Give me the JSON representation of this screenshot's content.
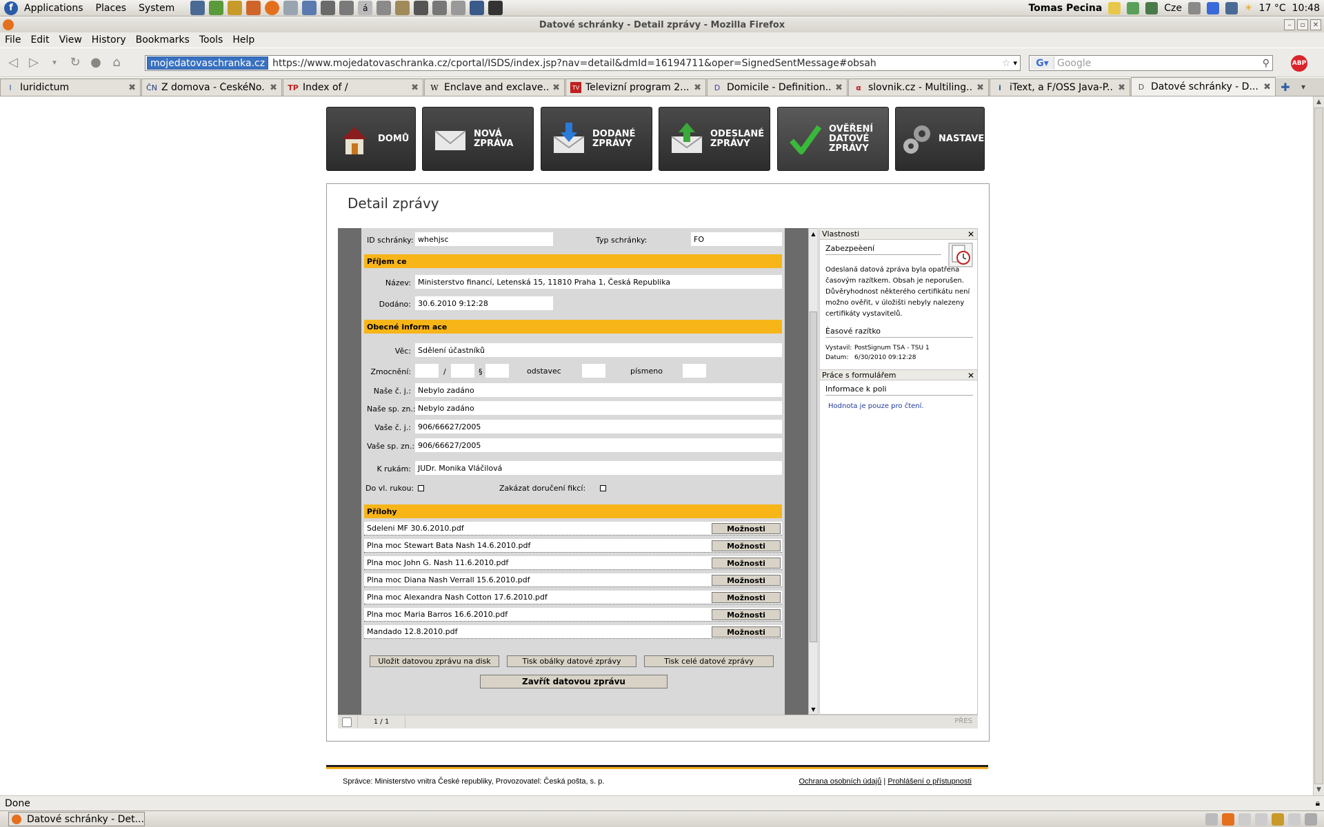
{
  "panel": {
    "menus": [
      "Applications",
      "Places",
      "System"
    ],
    "user": "Tomas Pecina",
    "keyboard": "Cze",
    "weather": "17 °C",
    "clock": "10:48"
  },
  "window": {
    "title": "Datové schránky - Detail zprávy - Mozilla Firefox"
  },
  "menubar": [
    "File",
    "Edit",
    "View",
    "History",
    "Bookmarks",
    "Tools",
    "Help"
  ],
  "navbar": {
    "site": "mojedatovaschranka.cz",
    "url": "https://www.mojedatovaschranka.cz/cportal/ISDS/index.jsp?nav=detail&dmId=16194711&oper=SignedSentMessage#obsah",
    "search_placeholder": "Google"
  },
  "tabs": [
    {
      "label": "Iuridictum",
      "icon": "I"
    },
    {
      "label": "Z domova - ČeskéNo...",
      "icon": "ČN"
    },
    {
      "label": "Index of /",
      "icon": "TP"
    },
    {
      "label": "Enclave and exclave...",
      "icon": "W"
    },
    {
      "label": "Televizní program 2...",
      "icon": "TV"
    },
    {
      "label": "Domicile - Definition...",
      "icon": "D"
    },
    {
      "label": "slovnik.cz - Multiling...",
      "icon": "α"
    },
    {
      "label": "iText, a F/OSS Java-P...",
      "icon": "i"
    },
    {
      "label": "Datové schránky - D...",
      "icon": "D"
    }
  ],
  "nav_buttons": [
    {
      "label1": "DOMŮ",
      "label2": "",
      "label3": ""
    },
    {
      "label1": "NOVÁ",
      "label2": "ZPRÁVA",
      "label3": ""
    },
    {
      "label1": "DODANÉ",
      "label2": "ZPRÁVY",
      "label3": ""
    },
    {
      "label1": "ODESLANÉ",
      "label2": "ZPRÁVY",
      "label3": ""
    },
    {
      "label1": "OVĚŘENÍ",
      "label2": "DATOVÉ",
      "label3": "ZPRÁVY"
    },
    {
      "label1": "NASTAVENÍ",
      "label2": "",
      "label3": ""
    }
  ],
  "detail": {
    "heading": "Detail zprávy",
    "id_label": "ID schránky:",
    "id_value": "whehjsc",
    "typ_label": "Typ schránky:",
    "typ_value": "FO",
    "sect_recipient": "Příjem ce",
    "nazev_label": "Název:",
    "nazev_value": "Ministerstvo financí, Letenská 15, 11810 Praha 1, Česká Republika",
    "dodano_label": "Dodáno:",
    "dodano_value": "30.6.2010  9:12:28",
    "sect_general": "Obecné inform ace",
    "vec_label": "Věc:",
    "vec_value": "Sdělení účastníků",
    "zmocneni_label": "Zmocnění:",
    "slash": "/",
    "para": "§",
    "odstavec_label": "odstavec",
    "pismeno_label": "písmeno",
    "nase_cj_label": "Naše č. j.:",
    "nase_cj_value": "Nebylo zadáno",
    "nase_spzn_label": "Naše sp. zn.:",
    "nase_spzn_value": "Nebylo zadáno",
    "vase_cj_label": "Vaše č. j.:",
    "vase_cj_value": "906/66627/2005",
    "vase_spzn_label": "Vaše sp. zn.:",
    "vase_spzn_value": "906/66627/2005",
    "krukam_label": "K rukám:",
    "krukam_value": "JUDr. Monika Vláčilová",
    "dovl_label": "Do vl. rukou:",
    "zakazat_label": "Zakázat doručení fikcí:",
    "sect_attach": "Přílohy",
    "attach_btn": "Možnosti",
    "attachments": [
      "Sdeleni MF 30.6.2010.pdf",
      "Plna moc Stewart Bata Nash 14.6.2010.pdf",
      "Plna moc  John G. Nash 11.6.2010.pdf",
      "Plna moc Diana Nash Verrall 15.6.2010.pdf",
      "Plna moc Alexandra Nash Cotton 17.6.2010.pdf",
      "Plna moc Maria Barros 16.6.2010.pdf",
      "Mandado 12.8.2010.pdf"
    ],
    "btn_save": "Uložit datovou zprávu na disk",
    "btn_print_env": "Tisk obálky datové zprávy",
    "btn_print_all": "Tisk celé datové zprávy",
    "btn_close": "Zavřít datovou zprávu"
  },
  "sidepanel": {
    "props_title": "Vlastnosti",
    "security_title": "Zabezpeèení",
    "security_text1": "Odeslaná datová zpráva byla opatřena",
    "security_text2": "časovým razítkem. Obsah je neporušen.",
    "security_text3": "Důvěryhodnost některého certifikátu není",
    "security_text4": "možno ověřit, v úložišti nebyly nalezeny",
    "security_text5": "certifikáty vystavitelů.",
    "stamp_title": "Èasové razítko",
    "issued_label": "Vystavil:",
    "issued_value": "PostSignum TSA - TSU 1",
    "date_label": "Datum:",
    "date_value": "6/30/2010 09:12:28",
    "form_title": "Práce s formulářem",
    "field_info_title": "Informace k poli",
    "field_info_text": "Hodnota je pouze pro čtení."
  },
  "pdfstatus": {
    "page": "1 / 1",
    "mode": "PŘES"
  },
  "footer": {
    "left": "Správce: Ministerstvo vnitra České republiky, Provozovatel: Česká pošta, s. p.",
    "link1": "Ochrana osobních údajů",
    "sep": "|",
    "link2": "Prohlášení o přístupnosti"
  },
  "status": {
    "text": "Done"
  },
  "taskbar": {
    "item": "Datové schránky - Det..."
  }
}
